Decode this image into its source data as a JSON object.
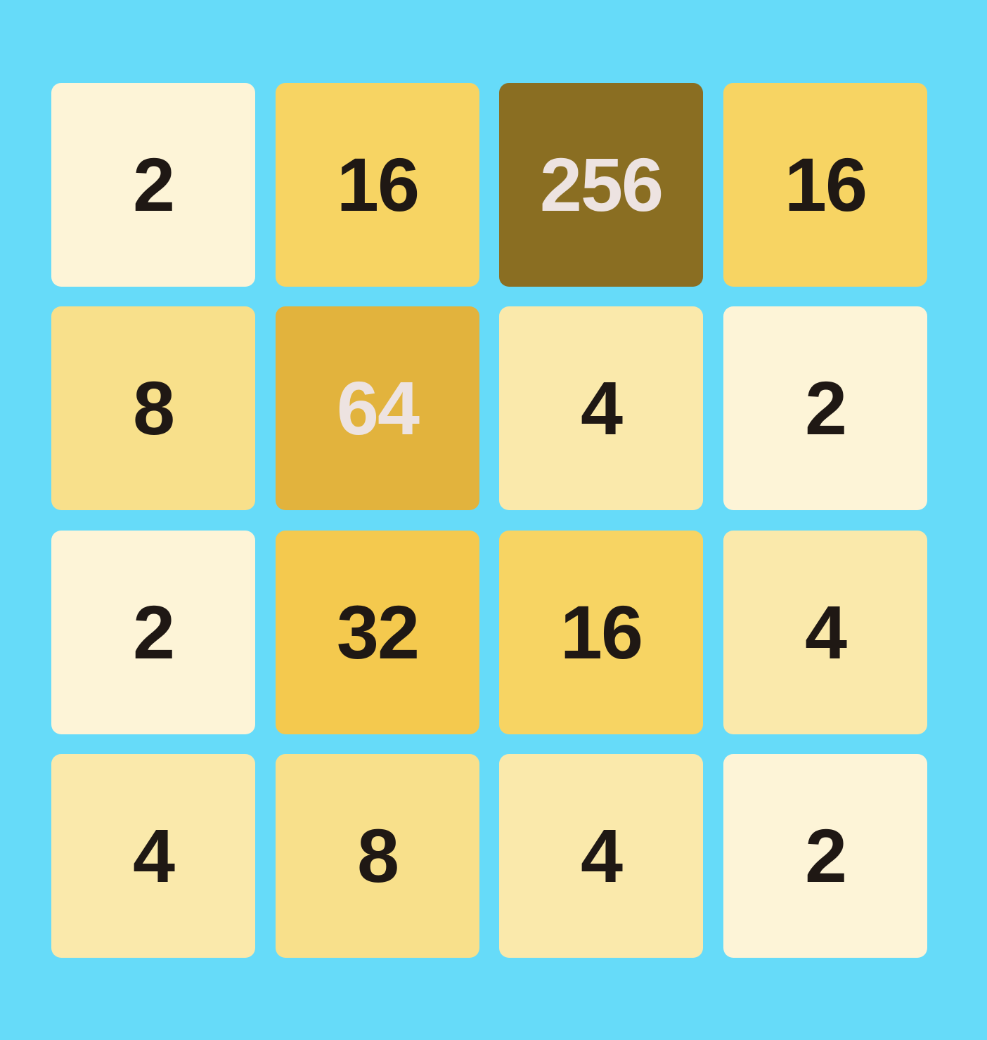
{
  "board": {
    "rows": [
      [
        {
          "value": "2",
          "bg": "#fdf4d7",
          "fg": "#1f1814"
        },
        {
          "value": "16",
          "bg": "#f7d463",
          "fg": "#1f1814"
        },
        {
          "value": "256",
          "bg": "#8a6e22",
          "fg": "#ede3e1"
        },
        {
          "value": "16",
          "bg": "#f7d463",
          "fg": "#1f1814"
        }
      ],
      [
        {
          "value": "8",
          "bg": "#f8e08b",
          "fg": "#1f1814"
        },
        {
          "value": "64",
          "bg": "#e2b33d",
          "fg": "#ede3e1"
        },
        {
          "value": "4",
          "bg": "#fae9ab",
          "fg": "#1f1814"
        },
        {
          "value": "2",
          "bg": "#fdf4d7",
          "fg": "#1f1814"
        }
      ],
      [
        {
          "value": "2",
          "bg": "#fdf4d7",
          "fg": "#1f1814"
        },
        {
          "value": "32",
          "bg": "#f4c94e",
          "fg": "#1f1814"
        },
        {
          "value": "16",
          "bg": "#f7d463",
          "fg": "#1f1814"
        },
        {
          "value": "4",
          "bg": "#fae9ab",
          "fg": "#1f1814"
        }
      ],
      [
        {
          "value": "4",
          "bg": "#fae9ab",
          "fg": "#1f1814"
        },
        {
          "value": "8",
          "bg": "#f8e08b",
          "fg": "#1f1814"
        },
        {
          "value": "4",
          "bg": "#fae9ab",
          "fg": "#1f1814"
        },
        {
          "value": "2",
          "bg": "#fdf4d7",
          "fg": "#1f1814"
        }
      ]
    ]
  },
  "colors": {
    "background": "#66dbf9"
  }
}
